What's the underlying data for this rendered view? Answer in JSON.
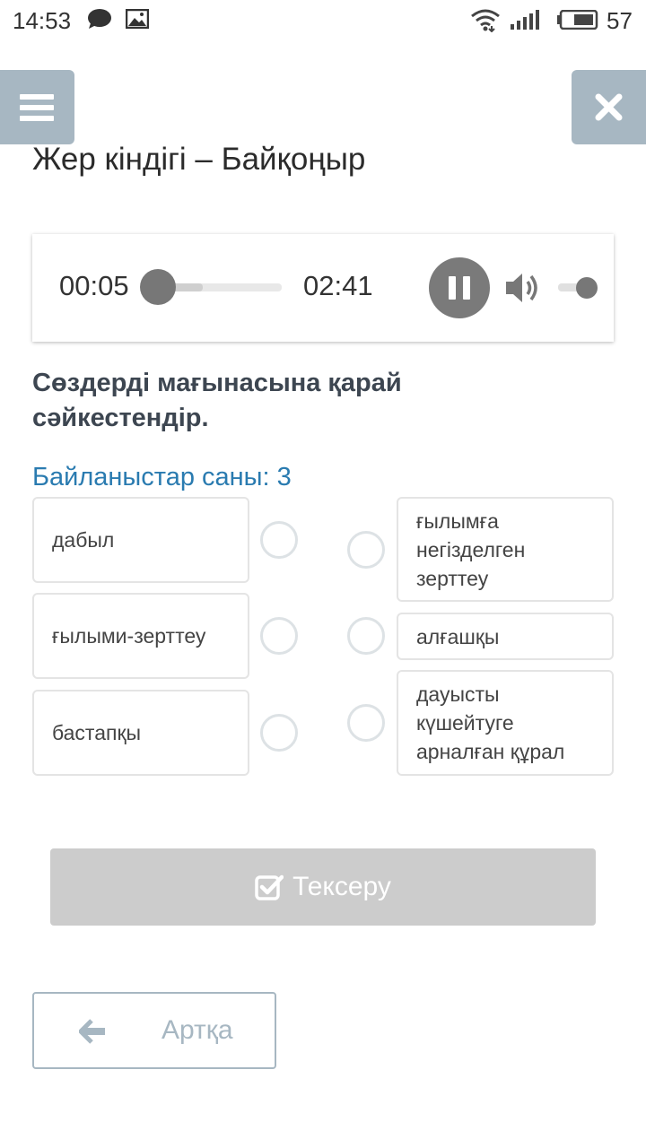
{
  "status_bar": {
    "time": "14:53",
    "battery": "57",
    "icons": [
      "chat-icon",
      "gallery-icon",
      "wifi-icon",
      "signal-icon",
      "battery-icon"
    ]
  },
  "header": {
    "title": "Жер кіндігі – Байқоңыр",
    "menu_icon": "hamburger-icon",
    "close_icon": "close-icon"
  },
  "player": {
    "current_time": "00:05",
    "duration": "02:41",
    "progress": 0.03,
    "state": "playing",
    "volume": 1.0
  },
  "task": {
    "instruction": "Сөздерді мағынасына қарай сәйкестендір.",
    "connections": "Байланыстар саны: 3"
  },
  "left_items": [
    {
      "label": "дабыл"
    },
    {
      "label": "ғылыми-зерттеу"
    },
    {
      "label": "бастапқы"
    }
  ],
  "right_items": [
    {
      "label": "ғылымға негізделген зерттеу"
    },
    {
      "label": "алғашқы"
    },
    {
      "label": "дауысты күшейтуге арналған құрал"
    }
  ],
  "buttons": {
    "check_label": "Тексеру",
    "back_label": "Артқа"
  },
  "colors": {
    "accent_grey_blue": "#a7b7c2",
    "link_blue": "#2a7bb0",
    "disabled_button": "#cccccc"
  }
}
